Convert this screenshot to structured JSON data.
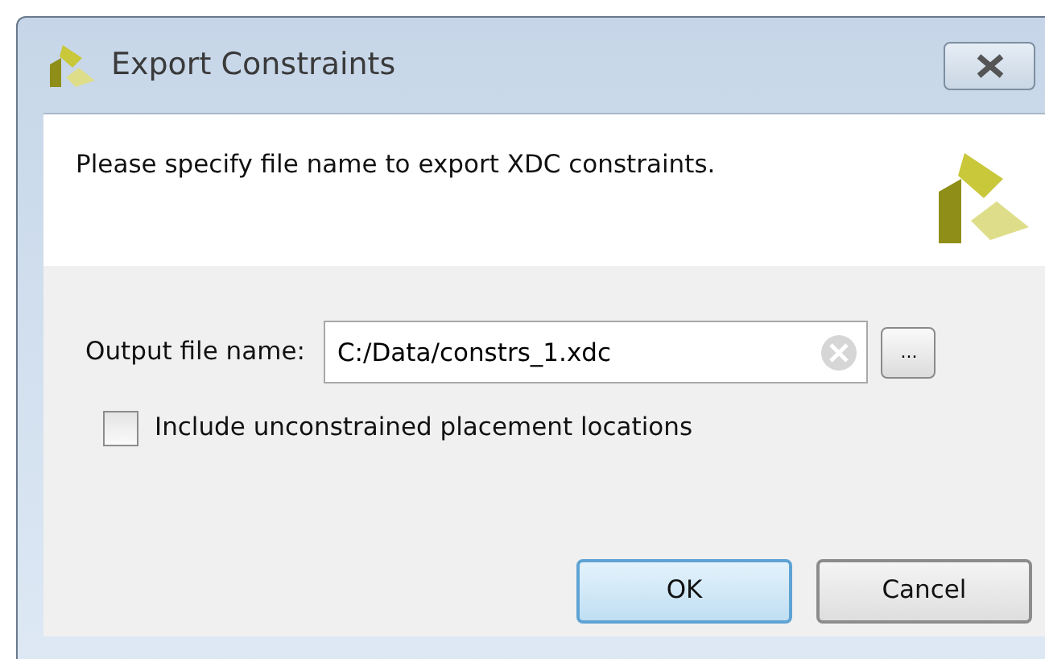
{
  "window": {
    "title": "Export Constraints"
  },
  "header": {
    "message": "Please specify file name to export XDC constraints."
  },
  "output_file": {
    "label": "Output file name:",
    "value": "C:/Data/constrs_1.xdc",
    "browse": "..."
  },
  "options": [
    {
      "label": "Include unconstrained placement locations",
      "checked": false
    }
  ],
  "buttons": [
    {
      "label": "OK",
      "kind": "default"
    },
    {
      "label": "Cancel",
      "kind": "normal"
    }
  ]
}
